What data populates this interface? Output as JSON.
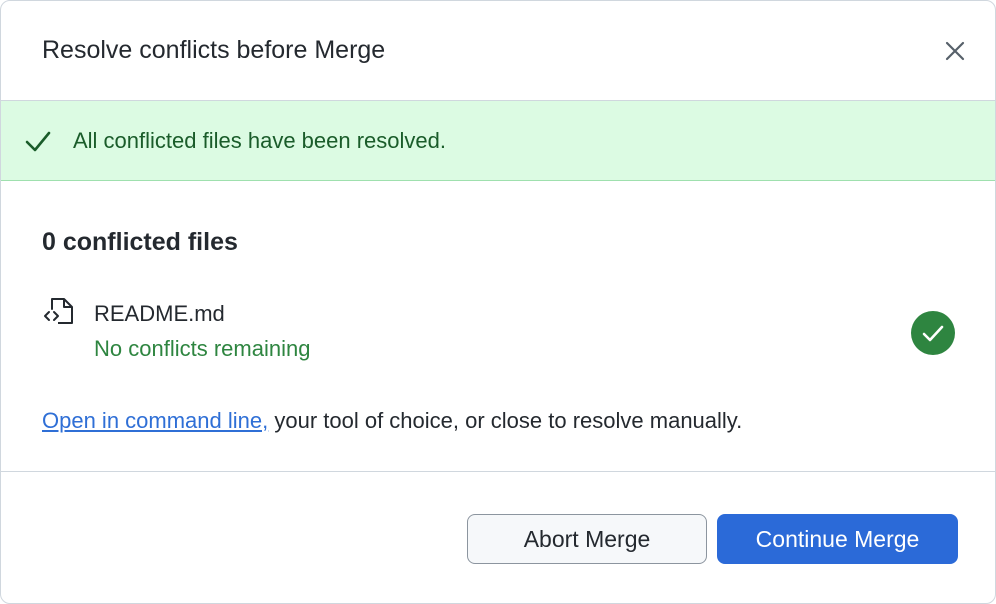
{
  "dialog": {
    "title": "Resolve conflicts before Merge",
    "close_icon": "close-icon"
  },
  "banner": {
    "icon": "check-icon",
    "text": "All conflicted files have been resolved.",
    "bg_color": "#dcfbe3",
    "text_color": "#1a5c2a"
  },
  "conflicts": {
    "count_label": "0 conflicted files",
    "files": [
      {
        "icon": "file-code-icon",
        "name": "README.md",
        "status": "No conflicts remaining",
        "status_icon": "check-circle-icon",
        "status_color": "#2e8540"
      }
    ]
  },
  "hint": {
    "link_text": "Open in command line,",
    "rest_text": " your tool of choice, or close to resolve manually."
  },
  "footer": {
    "abort_label": "Abort Merge",
    "continue_label": "Continue Merge",
    "accent_color": "#2b6ad8"
  }
}
